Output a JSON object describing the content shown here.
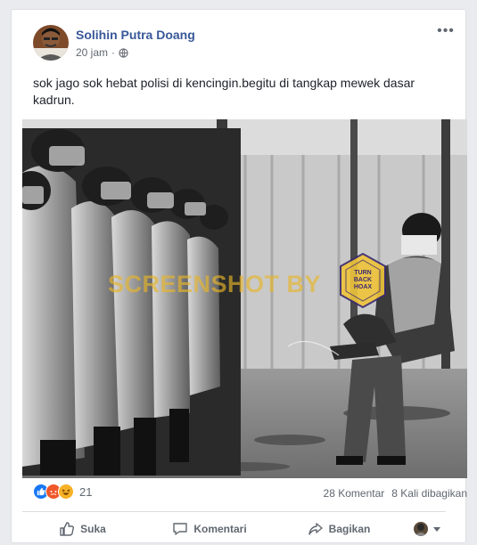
{
  "post": {
    "author": "Solihin Putra Doang",
    "time": "20 jam",
    "separator": "·",
    "text": "sok jago sok hebat polisi di kencingin.begitu di tangkap mewek dasar kadrun.",
    "privacy_icon": "globe-icon",
    "more_icon": "more-options-icon",
    "more_label": "•••"
  },
  "photo": {
    "watermark_text": "SCREENSHOT BY",
    "watermark_logo_lines": [
      "TURN",
      "BACK",
      "HOAX"
    ],
    "colors": {
      "watermark": "#e8b628",
      "logo_bg": "#efc43a"
    }
  },
  "stats": {
    "reaction_icons": [
      "like-icon",
      "angry-icon",
      "haha-icon"
    ],
    "reaction_count": "21",
    "comments": "28 Komentar",
    "shares": "8 Kali dibagikan"
  },
  "actions": {
    "like": "Suka",
    "comment": "Komentari",
    "share": "Bagikan"
  },
  "colors": {
    "author_link": "#385898",
    "like_blue": "#1877f2",
    "angry": "#f0572a",
    "haha": "#f7b125"
  }
}
